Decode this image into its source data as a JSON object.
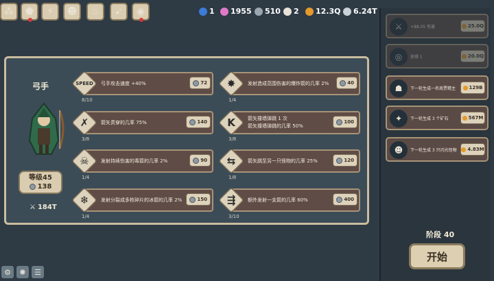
{
  "topbar": {
    "buttons": [
      {
        "name": "skill-tree-icon",
        "glyph": "⁂"
      },
      {
        "name": "shield-icon",
        "glyph": "⬟"
      },
      {
        "name": "lightning-icon",
        "glyph": "⚡"
      },
      {
        "name": "monster-icon",
        "glyph": "☻"
      },
      {
        "name": "fire-icon",
        "glyph": "♨"
      },
      {
        "name": "bow-icon",
        "glyph": "➹"
      },
      {
        "name": "barrel-icon",
        "glyph": "◉"
      }
    ],
    "resources": [
      {
        "name": "blue-orb-count",
        "value": "1",
        "color": "#3c7bd8"
      },
      {
        "name": "candy-count",
        "value": "1955",
        "color": "#e07ac8"
      },
      {
        "name": "ore-count",
        "value": "510",
        "color": "#9aa6b0"
      },
      {
        "name": "skull-count",
        "value": "2",
        "color": "#e8e3d8"
      },
      {
        "name": "gold-count",
        "value": "12.3Q",
        "color": "#e59a2b"
      },
      {
        "name": "power-count",
        "value": "6.24T",
        "color": "#c9d2d8"
      }
    ]
  },
  "hero": {
    "title": "弓手",
    "level": "等级45",
    "level_cost": "138",
    "power": "184T"
  },
  "upgrades_left": [
    {
      "icon": "SPEED",
      "icon_name": "speed-icon",
      "lines": [
        "弓手攻击速度 +40%"
      ],
      "price": "72",
      "progress": "8/10"
    },
    {
      "icon": "✗",
      "icon_name": "pierce-icon",
      "lines": [
        "箭矢贯穿的几率 75%"
      ],
      "price": "140",
      "progress": "3/8"
    },
    {
      "icon": "☠",
      "icon_name": "poison-skull-icon",
      "lines": [
        "发射持续伤害的毒箭的几率 2%"
      ],
      "price": "90",
      "progress": "1/4"
    },
    {
      "icon": "❄",
      "icon_name": "frost-icon",
      "lines": [
        "发射分裂成多枚碎片的冰箭的几率 2%"
      ],
      "price": "150",
      "progress": "1/4"
    }
  ],
  "upgrades_right": [
    {
      "icon": "✸",
      "icon_name": "explosion-icon",
      "lines": [
        "发射造成范围伤害的爆炸箭的几率 2%"
      ],
      "price": "40",
      "progress": "1/4"
    },
    {
      "icon": "K",
      "icon_name": "bounce-icon",
      "lines": [
        "箭矢撞墙弹跳 1 次",
        "箭矢撞墙弹跳的几率 50%"
      ],
      "price": "100",
      "progress": "3/8"
    },
    {
      "icon": "⇆",
      "icon_name": "ricochet-icon",
      "lines": [
        "箭矢跳至另一只怪物的几率 25%"
      ],
      "price": "120",
      "progress": "1/8"
    },
    {
      "icon": "⇶",
      "icon_name": "multishot-icon",
      "lines": [
        "额外发射一支箭的几率 60%"
      ],
      "price": "400",
      "progress": "3/10"
    }
  ],
  "side_cards": [
    {
      "icon": "⚔",
      "icon_name": "damage-icon",
      "text": "+88.05 伤害",
      "price": "25.0Q",
      "faded": true
    },
    {
      "icon": "◎",
      "icon_name": "portal-icon",
      "text": "获得 1",
      "price": "20.0Q",
      "faded": true
    },
    {
      "icon": "☗",
      "icon_name": "hero-spawn-icon",
      "text": "下一轮生成一名商贾精主",
      "price": "129B",
      "faded": false
    },
    {
      "icon": "✦",
      "icon_name": "crystal-icon",
      "text": "下一轮生成 3 个矿石",
      "price": "567M",
      "faded": false
    },
    {
      "icon": "☻",
      "icon_name": "monster-spawn-icon",
      "text": "下一轮生成 3 只闪光怪物",
      "price": "4.83M",
      "faded": false
    }
  ],
  "stage_label": "阶段 40",
  "start_label": "开始",
  "bottom_icons": [
    {
      "name": "settings-icon",
      "glyph": "⚙"
    },
    {
      "name": "spark-icon",
      "glyph": "✺"
    },
    {
      "name": "list-icon",
      "glyph": "☰"
    }
  ]
}
